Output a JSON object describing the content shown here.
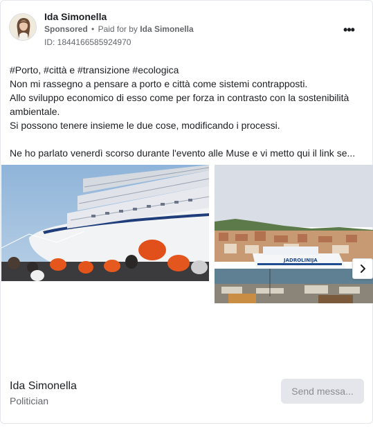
{
  "post": {
    "author_name": "Ida Simonella",
    "sponsored_label": "Sponsored",
    "separator": "•",
    "paid_for_prefix": "Paid for by",
    "payer_name": "Ida Simonella",
    "ad_id": "ID: 1844166585924970",
    "more_icon": "more-options-icon",
    "more_label": "•••",
    "body_lines": [
      "#Porto, #città e #transizione #ecologica",
      "Non mi rassegno a pensare a porto e città come sistemi contrapposti.",
      "Allo sviluppo economico di esso come per forza in contrasto con la sostenibilità",
      "ambientale.",
      "Si possono tenere insieme le due cose, modificando i processi.",
      "Ne ho parlato venerdì scorso durante l'evento alle Muse e vi metto qui il link se..."
    ]
  },
  "carousel": {
    "slides": [
      {
        "name": "cruise-ship-photo",
        "icon": "photo-cruise-ship-workers-hardhats"
      },
      {
        "name": "harbor-photo",
        "icon": "photo-ancona-harbor-ferry-jadrolinija",
        "caption_on_ship": "JADROLINIJA"
      }
    ],
    "next_icon": "chevron-right-icon"
  },
  "footer": {
    "page_name": "Ida Simonella",
    "page_category": "Politician",
    "cta_label": "Send messa..."
  },
  "colors": {
    "text_primary": "#1c1e21",
    "text_secondary": "#65676b",
    "cta_bg": "#e4e6eb",
    "cta_text": "#8a8d91",
    "border": "#e4e6eb"
  }
}
